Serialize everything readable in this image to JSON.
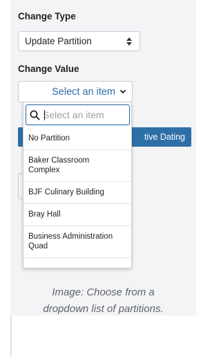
{
  "change_type": {
    "label": "Change Type",
    "selected": "Update Partition"
  },
  "change_value": {
    "label": "Change Value",
    "trigger_text": "Select an item"
  },
  "dropdown": {
    "search_placeholder": "Select an item",
    "items": [
      "No Partition",
      "Baker Classroom Complex",
      "BJF Culinary Building",
      "Bray Hall",
      "Business Administration Quad"
    ]
  },
  "behind_button": {
    "visible_text": "tive Dating"
  },
  "caption": {
    "line1": "Image: Choose from a",
    "line2": "dropdown list of partitions."
  },
  "colors": {
    "accent": "#2f6fa7",
    "card_bg": "#f3f4f6",
    "link_text": "#2c6ea8"
  }
}
